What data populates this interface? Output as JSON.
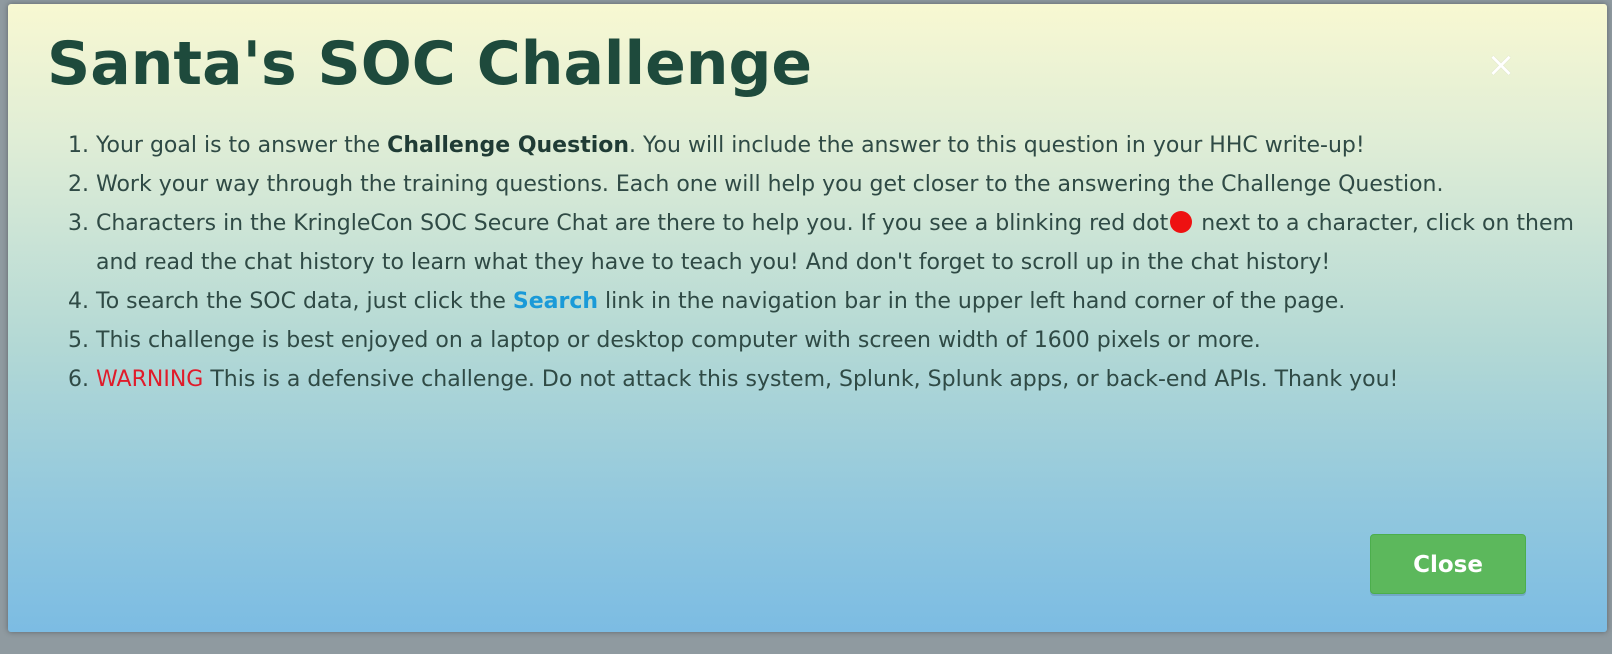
{
  "modal": {
    "title": "Santa's SOC Challenge",
    "close_icon_glyph": "×",
    "close_button_label": "Close"
  },
  "steps": [
    {
      "number": 1,
      "before": "Your goal is to answer the ",
      "bold": "Challenge Question",
      "after": ". You will include the answer to this question in your HHC write-up!"
    },
    {
      "number": 2,
      "text": "Work your way through the training questions. Each one will help you get closer to the answering the Challenge Question."
    },
    {
      "number": 3,
      "before": "Characters in the KringleCon SOC Secure Chat are there to help you. If you see a blinking red dot",
      "dot_icon": "red-dot-icon",
      "after": " next to a character, click on them and read the chat history to learn what they have to teach you! And don't forget to scroll up in the chat history!"
    },
    {
      "number": 4,
      "before": "To search the SOC data, just click the ",
      "link": "Search",
      "after": " link in the navigation bar in the upper left hand corner of the page."
    },
    {
      "number": 5,
      "text": "This challenge is best enjoyed on a laptop or desktop computer with screen width of 1600 pixels or more."
    },
    {
      "number": 6,
      "warning": "WARNING",
      "after": " This is a defensive challenge. Do not attack this system, Splunk, Splunk apps, or back-end APIs. Thank you!"
    }
  ],
  "colors": {
    "title": "#1e4a3c",
    "link": "#1a9ad8",
    "warning": "#e01b2a",
    "dot": "#ee1111",
    "close_button": "#5cb85c"
  }
}
